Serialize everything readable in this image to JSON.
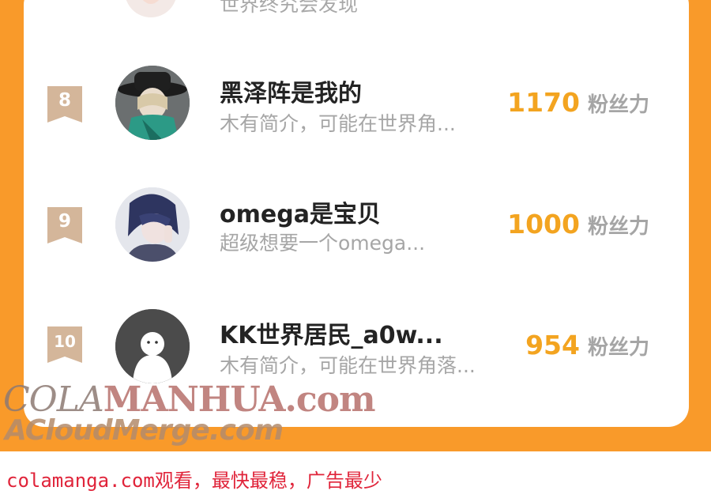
{
  "previous_entry": {
    "bio": "世界终究会发现"
  },
  "ranking": [
    {
      "rank": "8",
      "name": "黑泽阵是我的",
      "bio": "木有简介，可能在世界角...",
      "fans": "1170",
      "unit": "粉丝力"
    },
    {
      "rank": "9",
      "name": "omega是宝贝",
      "bio": "超级想要一个omega...",
      "fans": "1000",
      "unit": "粉丝力"
    },
    {
      "rank": "10",
      "name": "KK世界居民_a0w...",
      "bio": "木有简介，可能在世界角落...",
      "fans": "954",
      "unit": "粉丝力"
    }
  ],
  "watermark": {
    "cola_a": "COLA",
    "cola_b": "MANHUA.com",
    "cloud": "ACloudMerge.com"
  },
  "footer": {
    "text": "colamanga.com观看，最快最稳，广告最少"
  },
  "colors": {
    "accent_orange": "#f99a2a",
    "fans_number": "#f3a420",
    "rank_badge": "#d4b69a",
    "footer_text": "#e0243a"
  }
}
